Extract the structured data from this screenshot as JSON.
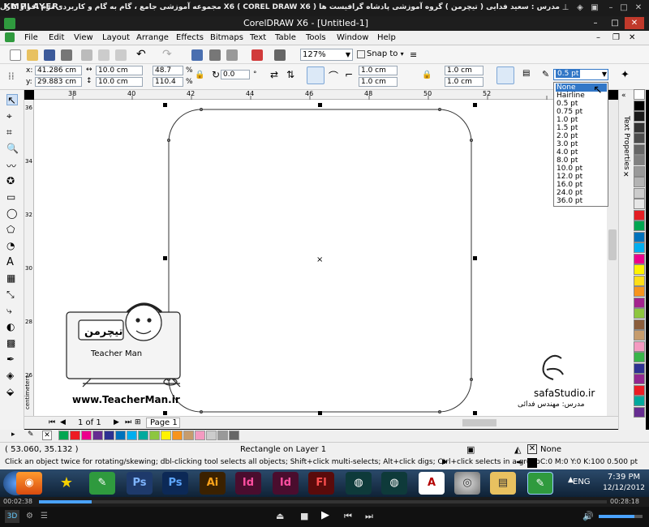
{
  "player": {
    "logo": "KMPLAYER",
    "title": "مجموعه آموزشی جامع ، گام به گام و کاربردی نرم افزار کارل دراو X6 ( COREL DRAW X6 )   مدرس : سعید فدایی ( تیچرمن ) گروه آموزشی پادشاه گرافیست ها",
    "time_elapsed": "00:02:38",
    "time_total": "00:28:18",
    "progress_fraction": 0.093
  },
  "window": {
    "title": "CorelDRAW X6 - [Untitled-1]"
  },
  "menu": {
    "items": [
      "File",
      "Edit",
      "View",
      "Layout",
      "Arrange",
      "Effects",
      "Bitmaps",
      "Text",
      "Table",
      "Tools",
      "Window",
      "Help"
    ]
  },
  "standard_toolbar": {
    "zoom": "127%",
    "snap_to": "Snap to"
  },
  "property_bar": {
    "x_label": "x:",
    "x": "41.286 cm",
    "y_label": "y:",
    "y": "29.883 cm",
    "width": "10.0 cm",
    "height": "10.0 cm",
    "scale_x": "48.7",
    "scale_y": "110.4",
    "percent": "%",
    "rotation": "0.0",
    "corner_tl": "1.0 cm",
    "corner_bl": "1.0 cm",
    "corner_tr": "1.0 cm",
    "corner_br": "1.0 cm",
    "outline_width": "0.5 pt"
  },
  "outline_dropdown": {
    "options": [
      "None",
      "Hairline",
      "0.5 pt",
      "0.75 pt",
      "1.0 pt",
      "1.5 pt",
      "2.0 pt",
      "3.0 pt",
      "4.0 pt",
      "8.0 pt",
      "10.0 pt",
      "12.0 pt",
      "16.0 pt",
      "24.0 pt",
      "36.0 pt"
    ],
    "highlighted": "None"
  },
  "ruler": {
    "h_ticks": [
      "38",
      "40",
      "42",
      "44",
      "46",
      "48",
      "50",
      "52"
    ],
    "v_ticks": [
      "36",
      "34",
      "32",
      "30",
      "28",
      "26"
    ],
    "unit": "centimeters"
  },
  "docker": {
    "tab": "Text Properties"
  },
  "canvas": {
    "watermark_left_name": "تیچرمن",
    "watermark_left_sub": "Teacher Man",
    "watermark_left_url": "www.TeacherMan.ir",
    "watermark_right_site": "safaStudio.ir",
    "watermark_right_author": "مدرس: مهندس فدائی"
  },
  "page_nav": {
    "page_count": "1 of 1",
    "page_tab": "Page 1"
  },
  "status": {
    "coords": "( 53.060, 35.132 )",
    "object_info": "Rectangle on Layer 1",
    "fill": "None",
    "hint": "Click an object twice for rotating/skewing; dbl-clicking tool selects all objects; Shift+click multi-selects; Alt+click digs; Ctrl+click selects in a group",
    "outline_info": "C:0 M:0 Y:0 K:100  0.500 pt"
  },
  "taskbar": {
    "apps": [
      "Firefox",
      "Favorites",
      "CorelDRAW",
      "Photoshop",
      "Photoshop",
      "Illustrator",
      "InDesign",
      "InDesign",
      "Flash",
      "3ds Max",
      "3ds Max",
      "AutoCAD",
      "Media",
      "Explorer",
      "CorelDRAW"
    ],
    "lang": "ENG",
    "time": "7:39 PM",
    "date": "12/12/2012"
  },
  "palette_colors": [
    "#ffffff",
    "#000000",
    "#1a1a1a",
    "#333333",
    "#4d4d4d",
    "#666666",
    "#808080",
    "#999999",
    "#b3b3b3",
    "#cccccc",
    "#e6e6e6",
    "#e31e24",
    "#00a651",
    "#0072bc",
    "#00aeef",
    "#ec008c",
    "#fff200",
    "#ffde17",
    "#f7941d",
    "#a3238e",
    "#8dc63f",
    "#8b5e3c",
    "#c69c6d",
    "#f49ac1",
    "#39b54a",
    "#2e3192",
    "#92278f",
    "#ed1c24",
    "#00a99d",
    "#662d91"
  ],
  "hpal_colors": [
    "#00a651",
    "#ed1c24",
    "#ec008c",
    "#662d91",
    "#2e3192",
    "#0072bc",
    "#00aeef",
    "#00a99d",
    "#8dc63f",
    "#fff200",
    "#f7941d",
    "#c69c6d",
    "#f49ac1",
    "#cccccc",
    "#999999",
    "#666666"
  ]
}
